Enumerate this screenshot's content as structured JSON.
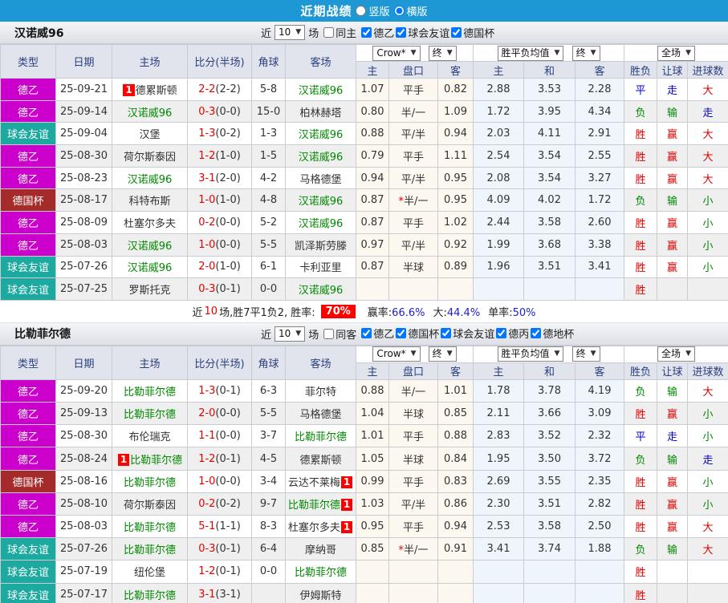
{
  "topbar": {
    "title": "近期战绩",
    "radios": [
      {
        "label": "竖版",
        "checked": false
      },
      {
        "label": "横版",
        "checked": true
      }
    ]
  },
  "table_header": {
    "cols": [
      "类型",
      "日期",
      "主场",
      "比分(半场)",
      "角球",
      "客场"
    ],
    "sub": [
      "主",
      "盘口",
      "客",
      "主",
      "和",
      "客",
      "胜负",
      "让球",
      "进球数"
    ],
    "odds_company": "Crow*",
    "final": "终",
    "avg_label": "胜平负均值",
    "scope": "全场"
  },
  "colors": {
    "topbar": "#1E97D5",
    "league": "#CC00CC",
    "friendly": "#1CAAA0",
    "cup": "#A52A2A",
    "team_highlight": "#008A00",
    "win": "#DD0000",
    "lose": "#008800",
    "draw": "#0000CC",
    "score": "#E60000",
    "rate_badge": "#FF0000",
    "stat_value": "#2020CC"
  },
  "sections": [
    {
      "team": "汉诺威96",
      "controls": {
        "near_label": "近",
        "count": "10",
        "games_label": "场",
        "same_venue": {
          "label": "同主",
          "checked": false
        },
        "leagues": [
          {
            "label": "德乙",
            "checked": true
          },
          {
            "label": "球会友谊",
            "checked": true
          },
          {
            "label": "德国杯",
            "checked": true
          }
        ]
      },
      "rows": [
        {
          "t": "德乙",
          "k": "league",
          "d": "25-09-21",
          "h": "德累斯顿",
          "hg": false,
          "hb": "1",
          "f": "2-2",
          "v": "(2-2)",
          "c": "5-8",
          "a": "汉诺威96",
          "ag": true,
          "ab": "",
          "o": [
            "1.07",
            "平手",
            "0.82"
          ],
          "st": false,
          "g": [
            "2.88",
            "3.53",
            "2.28"
          ],
          "r": [
            [
              "平",
              "b"
            ],
            [
              "走",
              "b"
            ],
            [
              "大",
              "r"
            ]
          ]
        },
        {
          "t": "德乙",
          "k": "league",
          "d": "25-09-14",
          "h": "汉诺威96",
          "hg": true,
          "hb": "",
          "f": "0-3",
          "v": "(0-0)",
          "c": "15-0",
          "a": "柏林赫塔",
          "ag": false,
          "ab": "",
          "o": [
            "0.80",
            "半/一",
            "1.09"
          ],
          "st": false,
          "g": [
            "1.72",
            "3.95",
            "4.34"
          ],
          "r": [
            [
              "负",
              "g"
            ],
            [
              "输",
              "g"
            ],
            [
              "走",
              "b"
            ]
          ]
        },
        {
          "t": "球会友谊",
          "k": "friendly",
          "d": "25-09-04",
          "h": "汉堡",
          "hg": false,
          "hb": "",
          "f": "1-3",
          "v": "(0-2)",
          "c": "1-3",
          "a": "汉诺威96",
          "ag": true,
          "ab": "",
          "o": [
            "0.88",
            "平/半",
            "0.94"
          ],
          "st": false,
          "g": [
            "2.03",
            "4.11",
            "2.91"
          ],
          "r": [
            [
              "胜",
              "r"
            ],
            [
              "赢",
              "r"
            ],
            [
              "大",
              "r"
            ]
          ]
        },
        {
          "t": "德乙",
          "k": "league",
          "d": "25-08-30",
          "h": "荷尔斯泰因",
          "hg": false,
          "hb": "",
          "f": "1-2",
          "v": "(1-0)",
          "c": "1-5",
          "a": "汉诺威96",
          "ag": true,
          "ab": "",
          "o": [
            "0.79",
            "平手",
            "1.11"
          ],
          "st": false,
          "g": [
            "2.54",
            "3.54",
            "2.55"
          ],
          "r": [
            [
              "胜",
              "r"
            ],
            [
              "赢",
              "r"
            ],
            [
              "大",
              "r"
            ]
          ]
        },
        {
          "t": "德乙",
          "k": "league",
          "d": "25-08-23",
          "h": "汉诺威96",
          "hg": true,
          "hb": "",
          "f": "3-1",
          "v": "(2-0)",
          "c": "4-2",
          "a": "马格德堡",
          "ag": false,
          "ab": "",
          "o": [
            "0.94",
            "平/半",
            "0.95"
          ],
          "st": false,
          "g": [
            "2.08",
            "3.54",
            "3.27"
          ],
          "r": [
            [
              "胜",
              "r"
            ],
            [
              "赢",
              "r"
            ],
            [
              "大",
              "r"
            ]
          ]
        },
        {
          "t": "德国杯",
          "k": "cup",
          "d": "25-08-17",
          "h": "科特布斯",
          "hg": false,
          "hb": "",
          "f": "1-0",
          "v": "(1-0)",
          "c": "4-8",
          "a": "汉诺威96",
          "ag": true,
          "ab": "",
          "o": [
            "0.87",
            "半/一",
            "0.95"
          ],
          "st": true,
          "g": [
            "4.09",
            "4.02",
            "1.72"
          ],
          "r": [
            [
              "负",
              "g"
            ],
            [
              "输",
              "g"
            ],
            [
              "小",
              "g"
            ]
          ]
        },
        {
          "t": "德乙",
          "k": "league",
          "d": "25-08-09",
          "h": "杜塞尔多夫",
          "hg": false,
          "hb": "",
          "f": "0-2",
          "v": "(0-0)",
          "c": "5-2",
          "a": "汉诺威96",
          "ag": true,
          "ab": "",
          "o": [
            "0.87",
            "平手",
            "1.02"
          ],
          "st": false,
          "g": [
            "2.44",
            "3.58",
            "2.60"
          ],
          "r": [
            [
              "胜",
              "r"
            ],
            [
              "赢",
              "r"
            ],
            [
              "小",
              "g"
            ]
          ]
        },
        {
          "t": "德乙",
          "k": "league",
          "d": "25-08-03",
          "h": "汉诺威96",
          "hg": true,
          "hb": "",
          "f": "1-0",
          "v": "(0-0)",
          "c": "5-5",
          "a": "凯泽斯劳滕",
          "ag": false,
          "ab": "",
          "o": [
            "0.97",
            "平/半",
            "0.92"
          ],
          "st": false,
          "g": [
            "1.99",
            "3.68",
            "3.38"
          ],
          "r": [
            [
              "胜",
              "r"
            ],
            [
              "赢",
              "r"
            ],
            [
              "小",
              "g"
            ]
          ]
        },
        {
          "t": "球会友谊",
          "k": "friendly",
          "d": "25-07-26",
          "h": "汉诺威96",
          "hg": true,
          "hb": "",
          "f": "2-0",
          "v": "(1-0)",
          "c": "6-1",
          "a": "卡利亚里",
          "ag": false,
          "ab": "",
          "o": [
            "0.87",
            "半球",
            "0.89"
          ],
          "st": false,
          "g": [
            "1.96",
            "3.51",
            "3.41"
          ],
          "r": [
            [
              "胜",
              "r"
            ],
            [
              "赢",
              "r"
            ],
            [
              "小",
              "g"
            ]
          ]
        },
        {
          "t": "球会友谊",
          "k": "friendly",
          "d": "25-07-25",
          "h": "罗斯托克",
          "hg": false,
          "hb": "",
          "f": "0-3",
          "v": "(0-1)",
          "c": "0-0",
          "a": "汉诺威96",
          "ag": true,
          "ab": "",
          "o": null,
          "st": false,
          "g": null,
          "r": [
            [
              "胜",
              "r"
            ],
            [
              "",
              ""
            ],
            [
              "",
              ""
            ]
          ]
        }
      ],
      "summary": {
        "prefix": "近",
        "count": "10",
        "mid": "场,胜7平1负2, 胜率:",
        "rate": "70%",
        "stats": [
          {
            "label": "赢率:",
            "value": "66.6%"
          },
          {
            "label": "大:",
            "value": "44.4%"
          },
          {
            "label": "单率:",
            "value": "50%"
          }
        ]
      }
    },
    {
      "team": "比勒菲尔德",
      "controls": {
        "near_label": "近",
        "count": "10",
        "games_label": "场",
        "same_venue": {
          "label": "同客",
          "checked": false
        },
        "leagues": [
          {
            "label": "德乙",
            "checked": true
          },
          {
            "label": "德国杯",
            "checked": true
          },
          {
            "label": "球会友谊",
            "checked": true
          },
          {
            "label": "德丙",
            "checked": true
          },
          {
            "label": "德地杯",
            "checked": true
          }
        ]
      },
      "rows": [
        {
          "t": "德乙",
          "k": "league",
          "d": "25-09-20",
          "h": "比勒菲尔德",
          "hg": true,
          "hb": "",
          "f": "1-3",
          "v": "(0-1)",
          "c": "6-3",
          "a": "菲尔特",
          "ag": false,
          "ab": "",
          "o": [
            "0.88",
            "半/一",
            "1.01"
          ],
          "st": false,
          "g": [
            "1.78",
            "3.78",
            "4.19"
          ],
          "r": [
            [
              "负",
              "g"
            ],
            [
              "输",
              "g"
            ],
            [
              "大",
              "r"
            ]
          ]
        },
        {
          "t": "德乙",
          "k": "league",
          "d": "25-09-13",
          "h": "比勒菲尔德",
          "hg": true,
          "hb": "",
          "f": "2-0",
          "v": "(0-0)",
          "c": "5-5",
          "a": "马格德堡",
          "ag": false,
          "ab": "",
          "o": [
            "1.04",
            "半球",
            "0.85"
          ],
          "st": false,
          "g": [
            "2.11",
            "3.66",
            "3.09"
          ],
          "r": [
            [
              "胜",
              "r"
            ],
            [
              "赢",
              "r"
            ],
            [
              "小",
              "g"
            ]
          ]
        },
        {
          "t": "德乙",
          "k": "league",
          "d": "25-08-30",
          "h": "布伦瑞克",
          "hg": false,
          "hb": "",
          "f": "1-1",
          "v": "(0-0)",
          "c": "3-7",
          "a": "比勒菲尔德",
          "ag": true,
          "ab": "",
          "o": [
            "1.01",
            "平手",
            "0.88"
          ],
          "st": false,
          "g": [
            "2.83",
            "3.52",
            "2.32"
          ],
          "r": [
            [
              "平",
              "b"
            ],
            [
              "走",
              "b"
            ],
            [
              "小",
              "g"
            ]
          ]
        },
        {
          "t": "德乙",
          "k": "league",
          "d": "25-08-24",
          "h": "比勒菲尔德",
          "hg": true,
          "hb": "1",
          "f": "1-2",
          "v": "(0-1)",
          "c": "4-5",
          "a": "德累斯顿",
          "ag": false,
          "ab": "",
          "o": [
            "1.05",
            "半球",
            "0.84"
          ],
          "st": false,
          "g": [
            "1.95",
            "3.50",
            "3.72"
          ],
          "r": [
            [
              "负",
              "g"
            ],
            [
              "输",
              "g"
            ],
            [
              "走",
              "b"
            ]
          ]
        },
        {
          "t": "德国杯",
          "k": "cup",
          "d": "25-08-16",
          "h": "比勒菲尔德",
          "hg": true,
          "hb": "",
          "f": "1-0",
          "v": "(0-0)",
          "c": "3-4",
          "a": "云达不莱梅",
          "ag": false,
          "ab": "1",
          "o": [
            "0.99",
            "平手",
            "0.83"
          ],
          "st": false,
          "g": [
            "2.69",
            "3.55",
            "2.35"
          ],
          "r": [
            [
              "胜",
              "r"
            ],
            [
              "赢",
              "r"
            ],
            [
              "小",
              "g"
            ]
          ]
        },
        {
          "t": "德乙",
          "k": "league",
          "d": "25-08-10",
          "h": "荷尔斯泰因",
          "hg": false,
          "hb": "",
          "f": "0-2",
          "v": "(0-2)",
          "c": "9-7",
          "a": "比勒菲尔德",
          "ag": true,
          "ab": "1",
          "o": [
            "1.03",
            "平/半",
            "0.86"
          ],
          "st": false,
          "g": [
            "2.30",
            "3.51",
            "2.82"
          ],
          "r": [
            [
              "胜",
              "r"
            ],
            [
              "赢",
              "r"
            ],
            [
              "小",
              "g"
            ]
          ]
        },
        {
          "t": "德乙",
          "k": "league",
          "d": "25-08-03",
          "h": "比勒菲尔德",
          "hg": true,
          "hb": "",
          "f": "5-1",
          "v": "(1-1)",
          "c": "8-3",
          "a": "杜塞尔多夫",
          "ag": false,
          "ab": "1",
          "o": [
            "0.95",
            "平手",
            "0.94"
          ],
          "st": false,
          "g": [
            "2.53",
            "3.58",
            "2.50"
          ],
          "r": [
            [
              "胜",
              "r"
            ],
            [
              "赢",
              "r"
            ],
            [
              "大",
              "r"
            ]
          ]
        },
        {
          "t": "球会友谊",
          "k": "friendly",
          "d": "25-07-26",
          "h": "比勒菲尔德",
          "hg": true,
          "hb": "",
          "f": "0-3",
          "v": "(0-1)",
          "c": "6-4",
          "a": "摩纳哥",
          "ag": false,
          "ab": "",
          "o": [
            "0.85",
            "半/一",
            "0.91"
          ],
          "st": true,
          "g": [
            "3.41",
            "3.74",
            "1.88"
          ],
          "r": [
            [
              "负",
              "g"
            ],
            [
              "输",
              "g"
            ],
            [
              "大",
              "r"
            ]
          ]
        },
        {
          "t": "球会友谊",
          "k": "friendly",
          "d": "25-07-19",
          "h": "纽伦堡",
          "hg": false,
          "hb": "",
          "f": "1-2",
          "v": "(0-1)",
          "c": "0-0",
          "a": "比勒菲尔德",
          "ag": true,
          "ab": "",
          "o": null,
          "st": false,
          "g": null,
          "r": [
            [
              "胜",
              "r"
            ],
            [
              "",
              ""
            ],
            [
              "",
              ""
            ]
          ]
        },
        {
          "t": "球会友谊",
          "k": "friendly",
          "d": "25-07-17",
          "h": "比勒菲尔德",
          "hg": true,
          "hb": "",
          "f": "3-1",
          "v": "(3-1)",
          "c": "",
          "a": "伊姆斯特",
          "ag": false,
          "ab": "",
          "o": null,
          "st": false,
          "g": null,
          "r": [
            [
              "胜",
              "r"
            ],
            [
              "",
              ""
            ],
            [
              "",
              ""
            ]
          ]
        }
      ],
      "summary": null
    }
  ]
}
